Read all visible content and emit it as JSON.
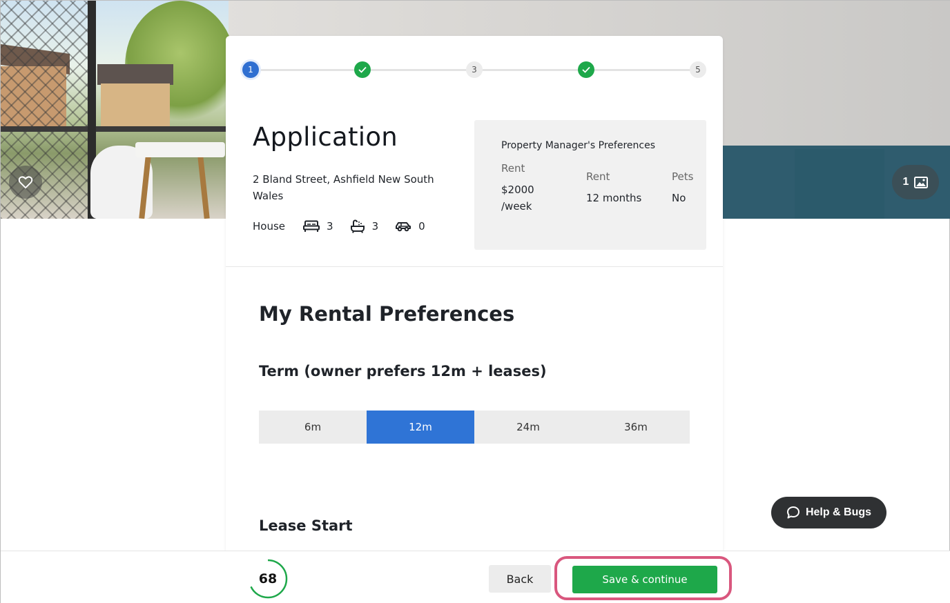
{
  "stepper": {
    "steps": [
      {
        "label": "1",
        "state": "active"
      },
      {
        "label": "",
        "state": "done"
      },
      {
        "label": "3",
        "state": "pending"
      },
      {
        "label": "",
        "state": "done"
      },
      {
        "label": "5",
        "state": "pending"
      }
    ]
  },
  "application": {
    "title": "Application",
    "address": "2 Bland Street, Ashfield New South Wales",
    "property_type": "House",
    "bedrooms": "3",
    "bathrooms": "3",
    "parking": "0"
  },
  "pm_preferences": {
    "title": "Property Manager's Preferences",
    "rent_label": "Rent",
    "rent_amount": "$2000",
    "rent_period": "/week",
    "term_label": "Rent",
    "term_value": "12 months",
    "pets_label": "Pets",
    "pets_value": "No"
  },
  "hero": {
    "photo_count": "1"
  },
  "rental_preferences": {
    "title": "My Rental Preferences",
    "term_title": "Term (owner prefers 12m + leases)",
    "term_options": [
      "6m",
      "12m",
      "24m",
      "36m"
    ],
    "term_selected": "12m",
    "lease_start_title": "Lease Start"
  },
  "help": {
    "label": "Help & Bugs"
  },
  "footer": {
    "score": "68",
    "score_percent": 68,
    "back_label": "Back",
    "save_label": "Save & continue"
  },
  "colors": {
    "primary_blue": "#2f74d6",
    "success_green": "#1ea84a",
    "highlight_pink": "#d9577e",
    "dark_button": "#2f3133"
  }
}
